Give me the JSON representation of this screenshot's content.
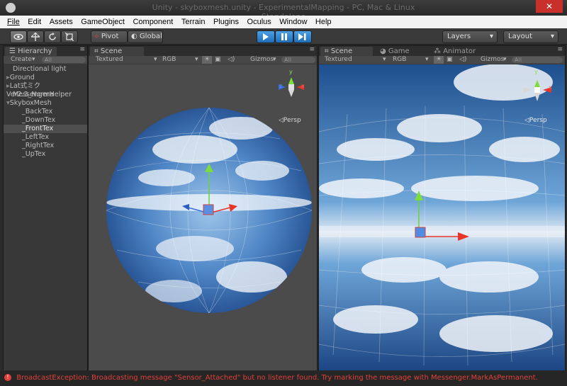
{
  "window": {
    "title": "Unity - skyboxmesh.unity - ExperimentalMapping - PC, Mac & Linux Standalone"
  },
  "menu": [
    "File",
    "Edit",
    "Assets",
    "GameObject",
    "Component",
    "Terrain",
    "Plugins",
    "Oculus",
    "Window",
    "Help"
  ],
  "toolbar": {
    "pivot_label": "Pivot",
    "global_label": "Global",
    "layers_label": "Layers",
    "layout_label": "Layout"
  },
  "hierarchy": {
    "tab_label": "Hierarchy",
    "create_label": "Create",
    "search_placeholder": "All",
    "items": [
      {
        "label": "Directional light"
      },
      {
        "label": "Ground"
      },
      {
        "label": "Lat式ミクVer2.3_Norma"
      },
      {
        "label": "MessengerHelper"
      },
      {
        "label": "SkyboxMesh"
      },
      {
        "label": "_BackTex"
      },
      {
        "label": "_DownTex"
      },
      {
        "label": "_FrontTex"
      },
      {
        "label": "_LeftTex"
      },
      {
        "label": "_RightTex"
      },
      {
        "label": "_UpTex"
      }
    ]
  },
  "scene_left": {
    "tab_label": "Scene",
    "render_mode": "Textured",
    "color_mode": "RGB",
    "gizmos_label": "Gizmos",
    "search_placeholder": "All",
    "persp_label": "Persp",
    "axis_y": "y",
    "axis_x": "x",
    "axis_z": "z"
  },
  "scene_right": {
    "tab_label": "Scene",
    "game_tab_label": "Game",
    "animator_tab_label": "Animator",
    "render_mode": "Textured",
    "color_mode": "RGB",
    "gizmos_label": "Gizmos",
    "search_placeholder": "All",
    "persp_label": "Persp",
    "axis_y": "y",
    "axis_x": "x"
  },
  "status": {
    "message": "BroadcastException: Broadcasting message \"Sensor_Attached\" but no listener found. Try marking the message with Messenger.MarkAsPermanent."
  }
}
